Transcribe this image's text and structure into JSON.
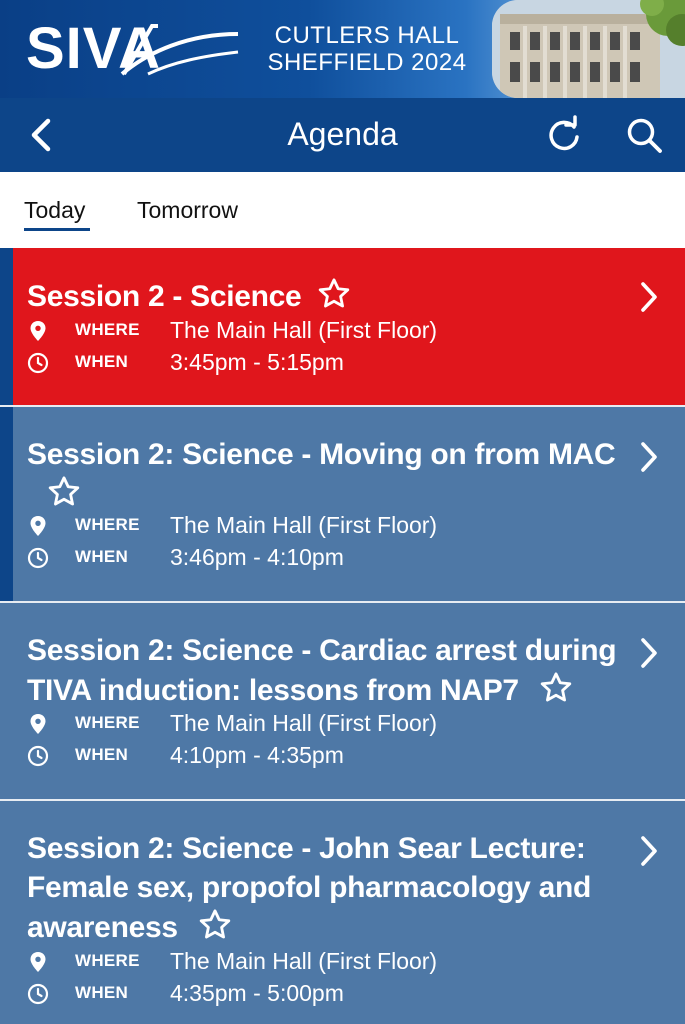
{
  "banner": {
    "logo": "SIVA",
    "venue_line1": "CUTLERS HALL",
    "venue_line2": "SHEFFIELD 2024"
  },
  "header": {
    "title": "Agenda",
    "back_icon": "chevron-left-icon",
    "refresh_icon": "refresh-icon",
    "search_icon": "search-icon"
  },
  "tabs": [
    {
      "label": "Today",
      "selected": true
    },
    {
      "label": "Tomorrow",
      "selected": false
    }
  ],
  "labels": {
    "where": "WHERE",
    "when": "WHEN"
  },
  "colors": {
    "brand_navy": "#0d4589",
    "current_session": "#e0161c",
    "session_card": "#4e78a6"
  },
  "sessions": [
    {
      "title": "Session 2 - Science",
      "where": "The Main Hall (First Floor)",
      "when": "3:45pm - 5:15pm",
      "current": true
    },
    {
      "title": "Session 2: Science - Moving on from MAC",
      "where": "The Main Hall (First Floor)",
      "when": "3:46pm - 4:10pm",
      "current": false
    },
    {
      "title": "Session 2: Science - Cardiac arrest during TIVA induction: lessons from NAP7",
      "where": "The Main Hall (First Floor)",
      "when": "4:10pm - 4:35pm",
      "current": false
    },
    {
      "title": "Session 2: Science - John Sear Lecture: Female sex, propofol pharmacology and awareness",
      "where": "The Main Hall (First Floor)",
      "when": "4:35pm - 5:00pm",
      "current": false
    }
  ]
}
